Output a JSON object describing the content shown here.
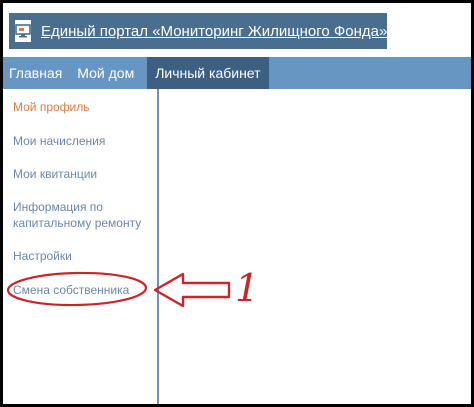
{
  "header": {
    "title": "Единый портал «Мониторинг Жилищного Фонда»"
  },
  "nav": {
    "tabs": [
      {
        "label": "Главная"
      },
      {
        "label": "Мой дом"
      },
      {
        "label": "Личный кабинет"
      }
    ]
  },
  "sidebar": {
    "items": [
      {
        "label": "Мой профиль"
      },
      {
        "label": "Мои начисления"
      },
      {
        "label": "Мои квитанции"
      },
      {
        "label": "Информация по капитальному ремонту"
      },
      {
        "label": "Настройки"
      },
      {
        "label": "Смена собственника"
      }
    ]
  },
  "annotation": {
    "number": "1"
  },
  "colors": {
    "header_bg": "#4a6e8e",
    "nav_bg": "#6796c3",
    "nav_active_bg": "#3d5f82",
    "active_link": "#e07b3e",
    "link": "#6b87a8",
    "annotation_red": "#c9252a"
  }
}
